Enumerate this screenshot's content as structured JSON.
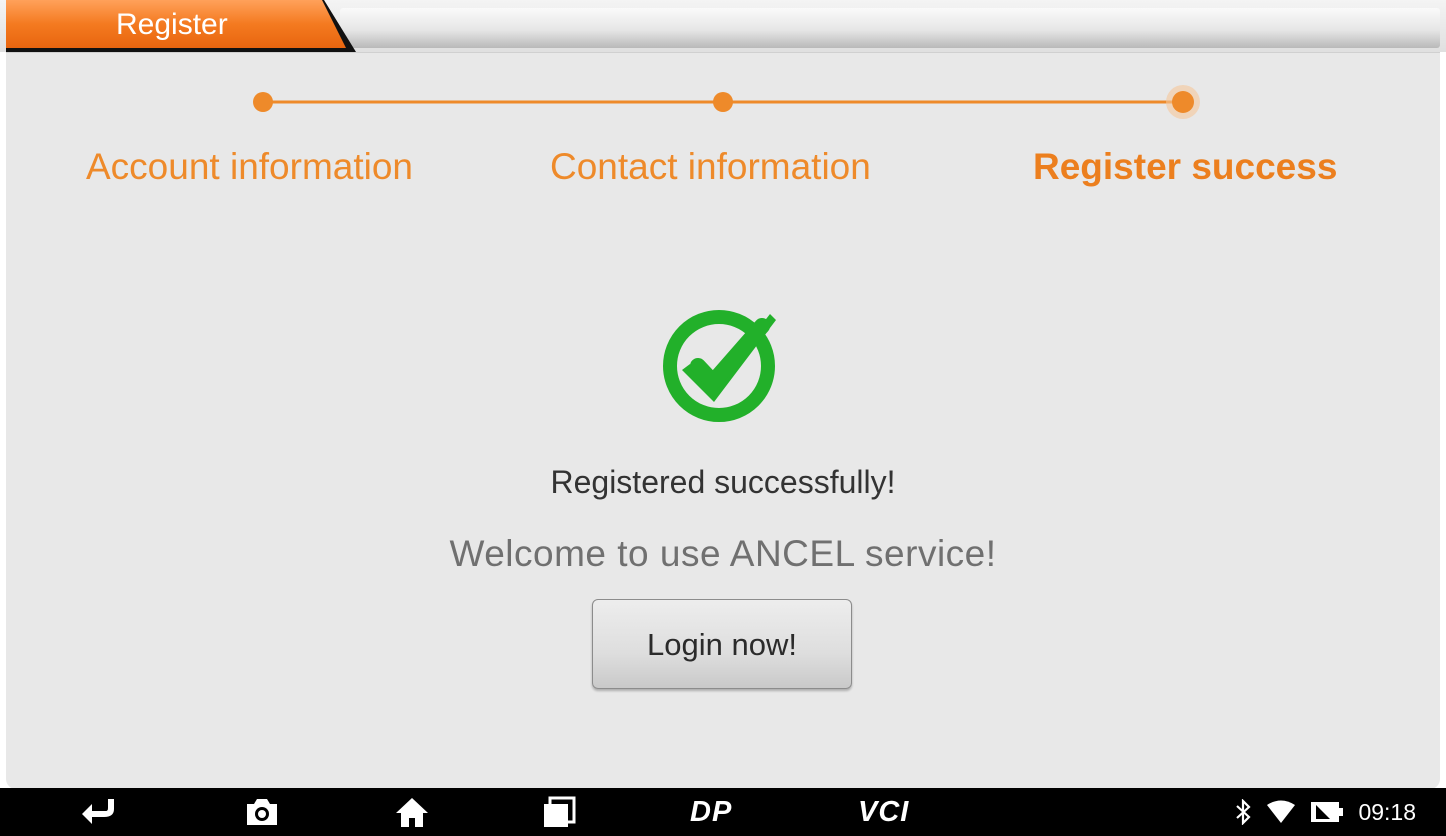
{
  "tab": {
    "title": "Register"
  },
  "steps": [
    {
      "label": "Account information",
      "state": "done"
    },
    {
      "label": "Contact information",
      "state": "done"
    },
    {
      "label": "Register success",
      "state": "active"
    }
  ],
  "result": {
    "icon": "check-circle-icon",
    "message": "Registered successfully!",
    "welcome": "Welcome to use ANCEL service!",
    "button_label": "Login now!"
  },
  "navbar": {
    "back_icon": "back-icon",
    "screenshot_icon": "camera-icon",
    "home_icon": "home-icon",
    "recent_icon": "recent-apps-icon",
    "dp_label": "DP",
    "vci_label": "VCI"
  },
  "status_bar": {
    "time": "09:18"
  },
  "colors": {
    "accent": "#ee8a2a",
    "success": "#22b02a",
    "panel": "#e8e8e8",
    "navbar": "#000000"
  }
}
